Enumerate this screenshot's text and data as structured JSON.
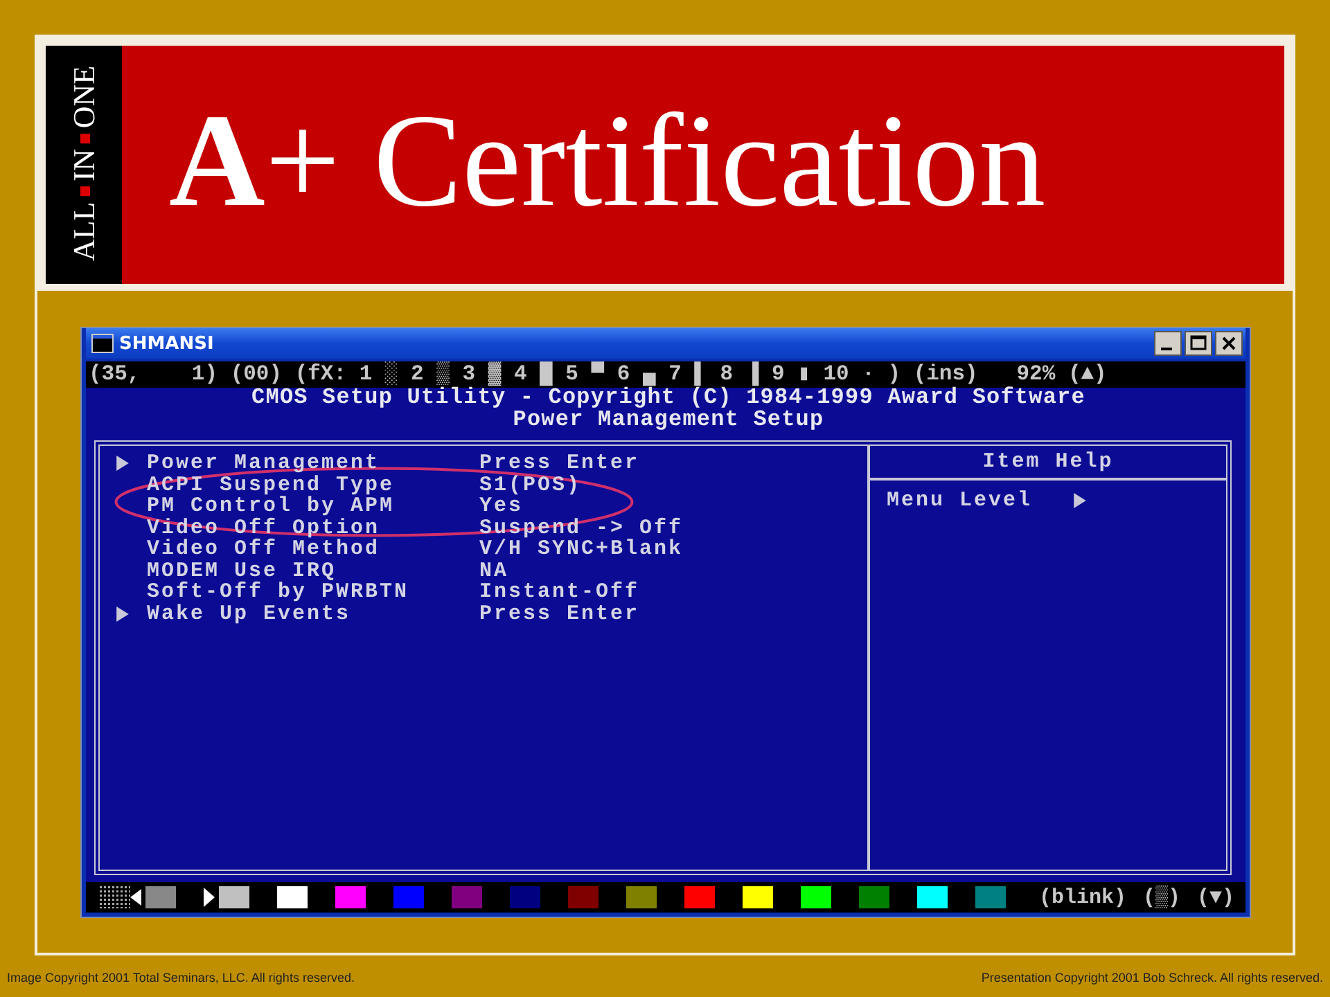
{
  "brand": {
    "words": [
      "ALL",
      "IN",
      "ONE"
    ]
  },
  "title": "**A**+ Certification",
  "window": {
    "title": "SHMANSI",
    "status_line": "(35,    1) (00) (fX: 1 ░ 2 ▒ 3 ▓ 4 █ 5 ▀ 6 ▄ 7 ▌ 8 ▐ 9 ▮ 10 · ) (ins)   92% (▲)",
    "header_lines": [
      "CMOS Setup Utility - Copyright (C) 1984-1999 Award Software",
      "Power Management Setup"
    ],
    "items": [
      {
        "label": "Power Management",
        "value": "Press Enter",
        "submenu": true,
        "circled": false
      },
      {
        "label": "ACPI Suspend Type",
        "value": "S1(POS)",
        "submenu": false,
        "circled": true
      },
      {
        "label": "PM Control by APM",
        "value": "Yes",
        "submenu": false,
        "circled": true
      },
      {
        "label": "Video Off Option",
        "value": "Suspend -> Off",
        "submenu": false,
        "circled": false
      },
      {
        "label": "Video Off Method",
        "value": "V/H SYNC+Blank",
        "submenu": false,
        "circled": false
      },
      {
        "label": "MODEM Use IRQ",
        "value": "NA",
        "submenu": false,
        "circled": false
      },
      {
        "label": "Soft-Off by PWRBTN",
        "value": "Instant-Off",
        "submenu": false,
        "circled": false
      },
      {
        "label": "Wake Up Events",
        "value": "Press Enter",
        "submenu": true,
        "circled": false
      }
    ],
    "help": {
      "title": "Item Help",
      "label": "Menu Level"
    },
    "palette": [
      {
        "kind": "left",
        "color": "#888888"
      },
      {
        "kind": "right",
        "color": "#c0c0c0"
      },
      {
        "kind": "swatch",
        "color": "#ffffff"
      },
      {
        "kind": "swatch",
        "color": "#ff00ff"
      },
      {
        "kind": "swatch",
        "color": "#0000ff"
      },
      {
        "kind": "swatch",
        "color": "#800080"
      },
      {
        "kind": "swatch",
        "color": "#000080"
      },
      {
        "kind": "swatch",
        "color": "#800000"
      },
      {
        "kind": "swatch",
        "color": "#808000"
      },
      {
        "kind": "swatch",
        "color": "#ff0000"
      },
      {
        "kind": "swatch",
        "color": "#ffff00"
      },
      {
        "kind": "swatch",
        "color": "#00ff00"
      },
      {
        "kind": "swatch",
        "color": "#008000"
      },
      {
        "kind": "swatch",
        "color": "#00ffff"
      },
      {
        "kind": "swatch",
        "color": "#008080"
      }
    ],
    "palette_labels": [
      "(blink)",
      "(▒)",
      "(▼)"
    ]
  },
  "footer": {
    "left": "Image Copyright 2001 Total Seminars, LLC. All rights reserved.",
    "right": "Presentation Copyright 2001 Bob Schreck. All rights reserved."
  }
}
